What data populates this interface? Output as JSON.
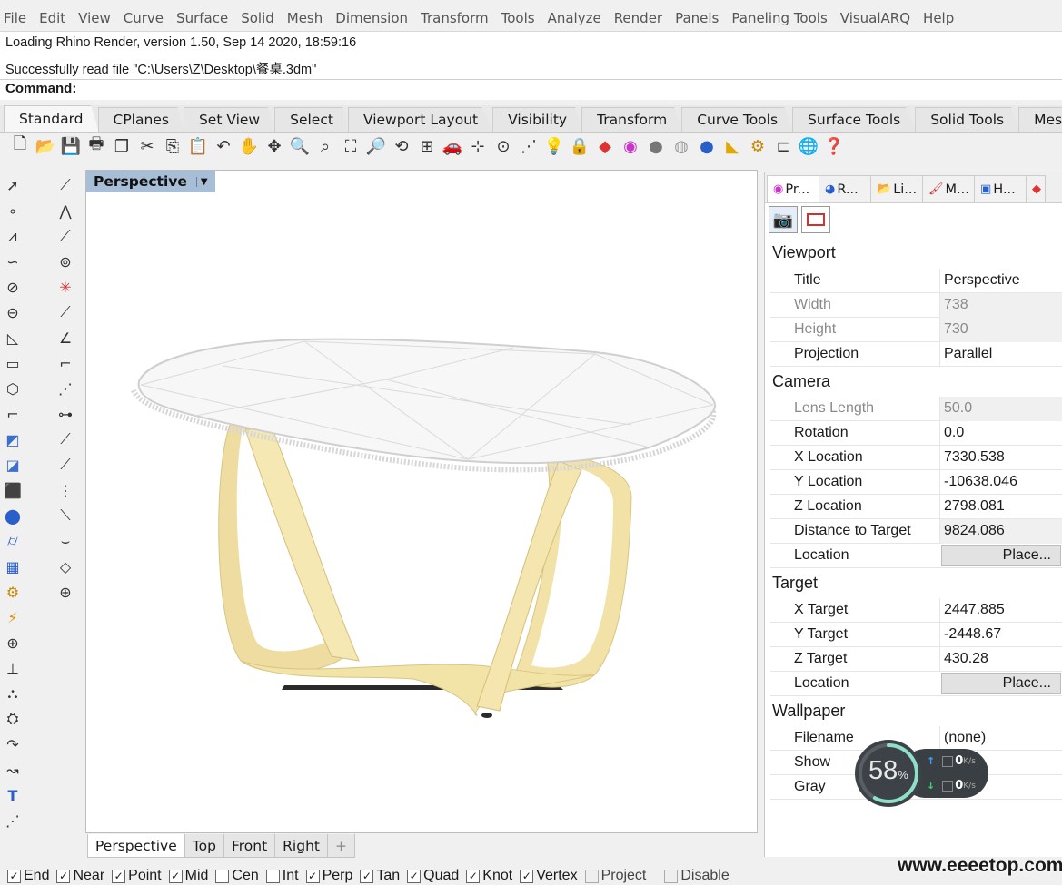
{
  "menu": [
    "File",
    "Edit",
    "View",
    "Curve",
    "Surface",
    "Solid",
    "Mesh",
    "Dimension",
    "Transform",
    "Tools",
    "Analyze",
    "Render",
    "Panels",
    "Paneling Tools",
    "VisualARQ",
    "Help"
  ],
  "command_history": [
    "Loading Rhino Render, version 1.50, Sep 14 2020, 18:59:16",
    "Successfully read file \"C:\\Users\\Z\\Desktop\\餐桌.3dm\""
  ],
  "command_prompt": "Command:",
  "toolbar_tabs": [
    "Standard",
    "CPlanes",
    "Set View",
    "Select",
    "Viewport Layout",
    "Visibility",
    "Transform",
    "Curve Tools",
    "Surface Tools",
    "Solid Tools",
    "Mesh T"
  ],
  "viewport": {
    "title": "Perspective",
    "bottom_tabs": [
      "Perspective",
      "Top",
      "Front",
      "Right"
    ],
    "add_tab": "+"
  },
  "panel": {
    "tabs": [
      "Pr...",
      "R...",
      "Li...",
      "M...",
      "H..."
    ],
    "sections": {
      "viewport": "Viewport",
      "camera": "Camera",
      "target": "Target",
      "wallpaper": "Wallpaper"
    },
    "viewport_rows": [
      {
        "key": "Title",
        "value": "Perspective"
      },
      {
        "key": "Width",
        "value": "738"
      },
      {
        "key": "Height",
        "value": "730"
      },
      {
        "key": "Projection",
        "value": "Parallel"
      }
    ],
    "camera_rows": [
      {
        "key": "Lens Length",
        "value": "50.0"
      },
      {
        "key": "Rotation",
        "value": "0.0"
      },
      {
        "key": "X Location",
        "value": "7330.538"
      },
      {
        "key": "Y Location",
        "value": "-10638.046"
      },
      {
        "key": "Z Location",
        "value": "2798.081"
      },
      {
        "key": "Distance to Target",
        "value": "9824.086"
      },
      {
        "key": "Location",
        "value": "Place..."
      }
    ],
    "target_rows": [
      {
        "key": "X Target",
        "value": "2447.885"
      },
      {
        "key": "Y Target",
        "value": "-2448.67"
      },
      {
        "key": "Z Target",
        "value": "430.28"
      },
      {
        "key": "Location",
        "value": "Place..."
      }
    ],
    "wallpaper_rows": [
      {
        "key": "Filename",
        "value": "(none)"
      },
      {
        "key": "Show",
        "value": ""
      },
      {
        "key": "Gray",
        "value": ""
      }
    ]
  },
  "osnaps": [
    {
      "label": "End",
      "checked": true
    },
    {
      "label": "Near",
      "checked": true
    },
    {
      "label": "Point",
      "checked": true
    },
    {
      "label": "Mid",
      "checked": true
    },
    {
      "label": "Cen",
      "checked": false
    },
    {
      "label": "Int",
      "checked": false
    },
    {
      "label": "Perp",
      "checked": true
    },
    {
      "label": "Tan",
      "checked": true
    },
    {
      "label": "Quad",
      "checked": true
    },
    {
      "label": "Knot",
      "checked": true
    },
    {
      "label": "Vertex",
      "checked": true
    },
    {
      "label": "Project",
      "checked": false
    },
    {
      "label": "Disable",
      "checked": false
    }
  ],
  "net_widget": {
    "percent": "58",
    "percent_unit": "%",
    "upload": "0",
    "download": "0",
    "rate_unit": "K/s",
    "ring_fraction": 0.58
  },
  "watermark": "www.eeeetop.com",
  "colors": {
    "viewport_title_bg": "#a8bdd6",
    "table_leg": "#f2e3a6",
    "tabletop_wire": "#cfcfcf"
  }
}
